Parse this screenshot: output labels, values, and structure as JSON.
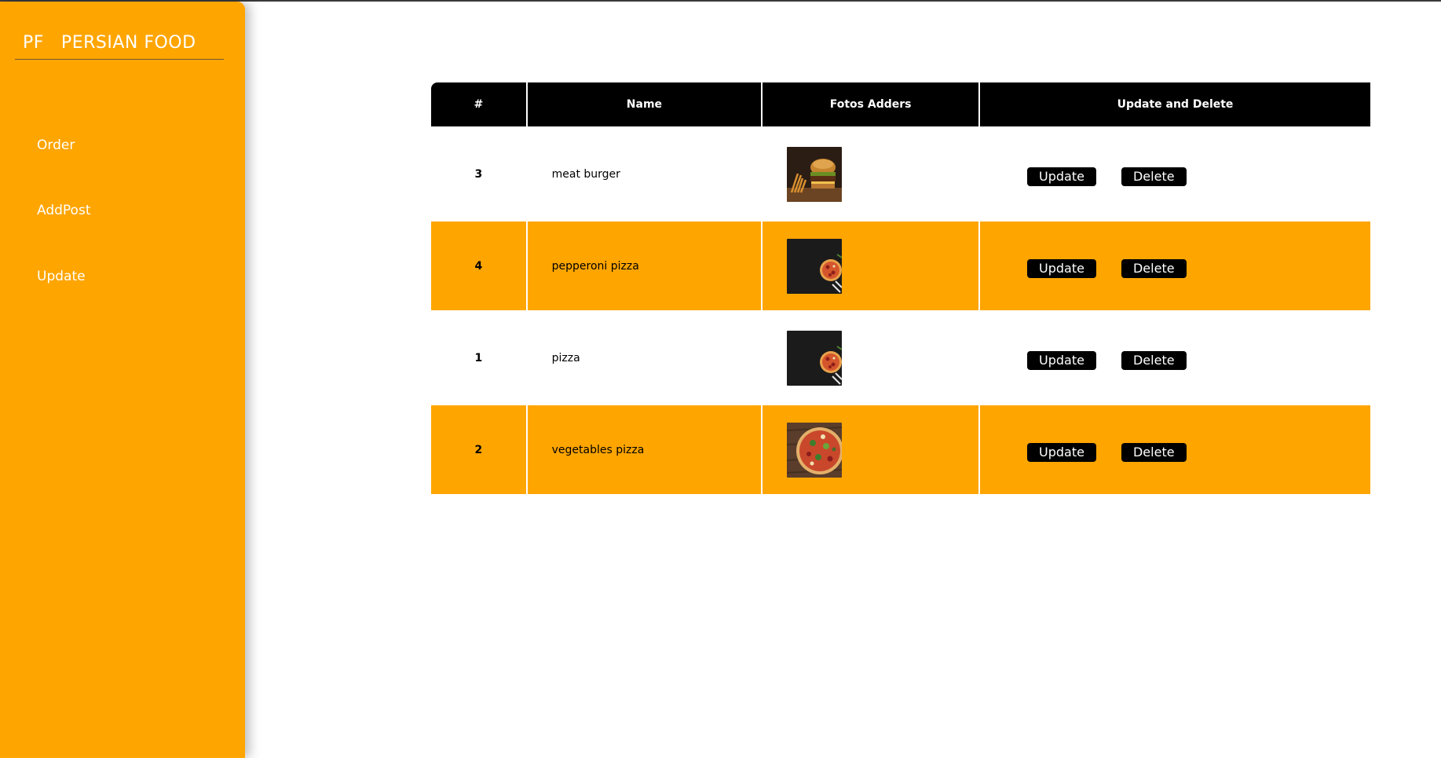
{
  "brand": {
    "abbr": "PF",
    "name": "PERSIAN FOOD"
  },
  "sidebar": {
    "items": [
      {
        "label": "Order"
      },
      {
        "label": "AddPost"
      },
      {
        "label": "Update"
      }
    ]
  },
  "table": {
    "headers": [
      "#",
      "Name",
      "Fotos Adders",
      "Update and Delete"
    ],
    "rows": [
      {
        "id": "3",
        "name": "meat burger",
        "photo_icon": "burger-photo-icon",
        "update_label": "Update",
        "delete_label": "Delete"
      },
      {
        "id": "4",
        "name": "pepperoni pizza",
        "photo_icon": "pepperoni-pizza-photo-icon",
        "update_label": "Update",
        "delete_label": "Delete"
      },
      {
        "id": "1",
        "name": "pizza",
        "photo_icon": "pizza-photo-icon",
        "update_label": "Update",
        "delete_label": "Delete"
      },
      {
        "id": "2",
        "name": "vegetables pizza",
        "photo_icon": "vegetable-pizza-photo-icon",
        "update_label": "Update",
        "delete_label": "Delete"
      }
    ]
  },
  "colors": {
    "accent": "#FFA500",
    "header_bg": "#000000",
    "text_light": "#FFFFFF"
  }
}
